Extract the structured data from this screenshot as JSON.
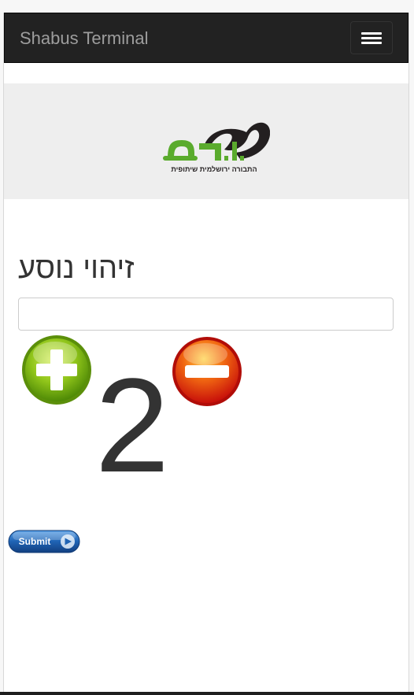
{
  "navbar": {
    "brand": "Shabus Terminal",
    "menu_toggle_icon": "hamburger-menu-icon"
  },
  "logo": {
    "wordmark": "שבו.ס",
    "tagline": "התבורה ירושלמית שיתופית",
    "colors": {
      "green": "#5aab2d",
      "dark": "#231f20"
    }
  },
  "form": {
    "title": "זיהוי נוסע",
    "passenger_id": {
      "value": "",
      "placeholder": ""
    },
    "plus_icon": "plus-circle-icon",
    "minus_icon": "minus-circle-icon",
    "counter_value": "2",
    "submit_label": "Submit"
  },
  "colors": {
    "navbar_bg": "#222222",
    "hero_bg": "#eeeeee",
    "plus_green": "#7dbb16",
    "minus_red": "#e61a0a",
    "submit_blue": "#1b5ea8"
  }
}
